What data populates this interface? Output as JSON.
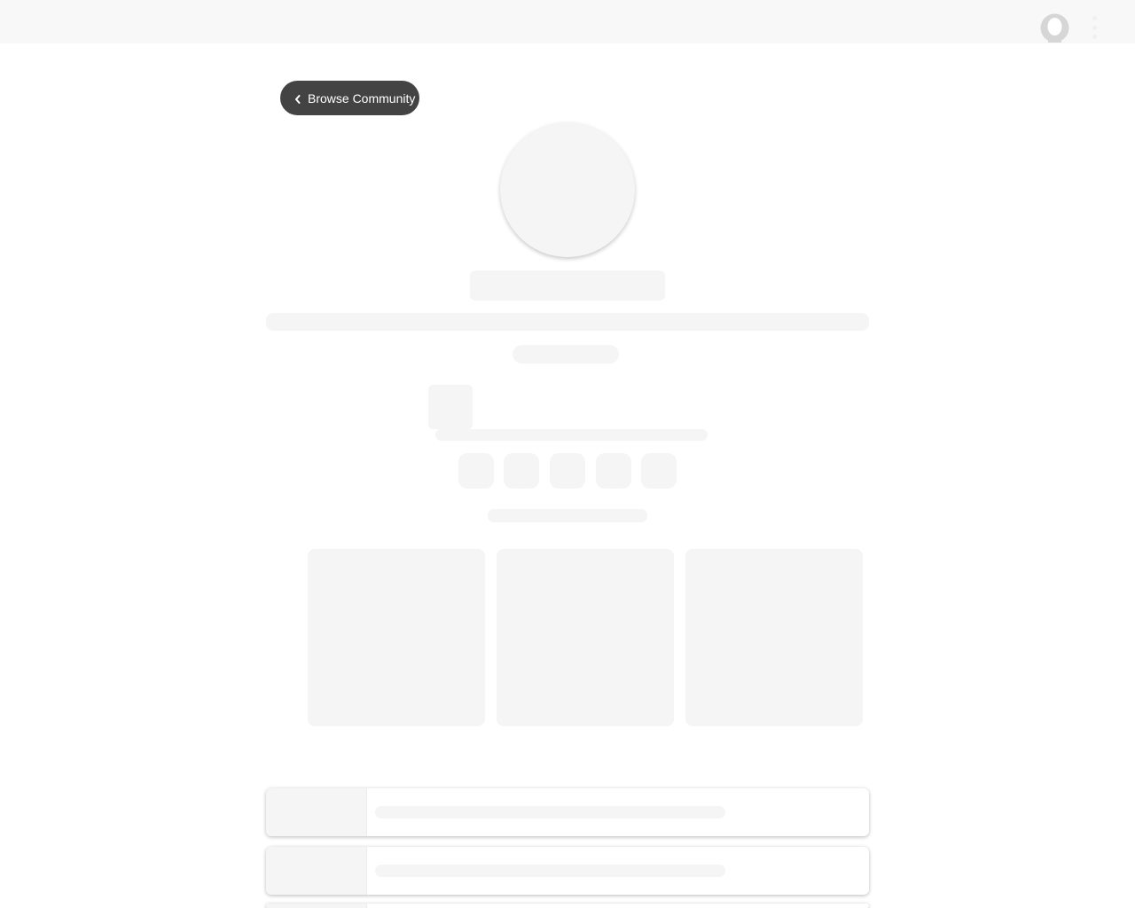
{
  "header": {
    "avatar_icon": "user-avatar-icon",
    "menu_icon": "kebab-menu-icon"
  },
  "nav": {
    "back_label": "Browse Community",
    "back_icon": "chevron-left-icon"
  },
  "colors": {
    "topbar_bg": "#f8f8f8",
    "button_bg": "#434343",
    "skeleton": "#f5f5f5"
  }
}
